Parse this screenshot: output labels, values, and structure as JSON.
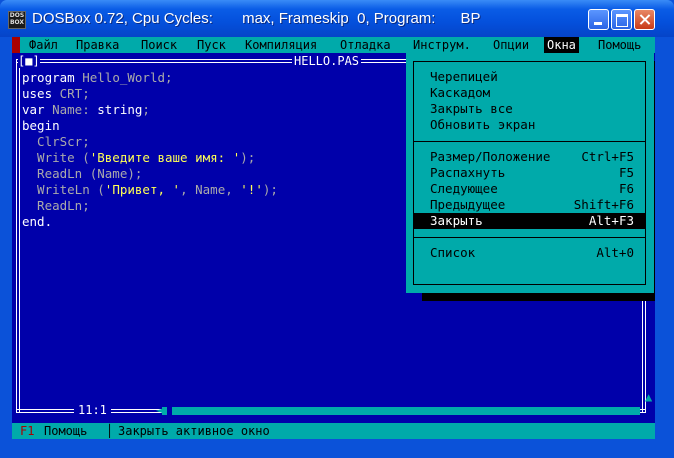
{
  "window": {
    "title": "DOSBox 0.72, Cpu Cycles:       max, Frameskip  0, Program:      BP",
    "icon_text": "DOS BOX"
  },
  "menubar": {
    "items": [
      "Файл",
      "Правка",
      "Поиск",
      "Пуск",
      "Компиляция",
      "Отладка",
      "Инструм.",
      "Опции",
      "Окна",
      "Помощь"
    ],
    "active": "Окна"
  },
  "editor": {
    "close_box": "[■]",
    "file_name": "HELLO.PAS",
    "cursor_position": "11:1",
    "code": [
      "program Hello_World;",
      "uses CRT;",
      "var Name: string;",
      "begin",
      "  ClrScr;",
      "  Write ('Введите ваше имя: ');",
      "  ReadLn (Name);",
      "  WriteLn ('Привет, ', Name, '!');",
      "  ReadLn;",
      "end."
    ]
  },
  "windows_menu": {
    "group1": [
      {
        "label": "Черепицей",
        "shortcut": ""
      },
      {
        "label": "Каскадом",
        "shortcut": ""
      },
      {
        "label": "Закрыть все",
        "shortcut": ""
      },
      {
        "label": "Обновить экран",
        "shortcut": ""
      }
    ],
    "group2": [
      {
        "label": "Размер/Положение",
        "shortcut": "Ctrl+F5"
      },
      {
        "label": "Распахнуть",
        "shortcut": "F5"
      },
      {
        "label": "Следующее",
        "shortcut": "F6"
      },
      {
        "label": "Предыдущее",
        "shortcut": "Shift+F6"
      },
      {
        "label": "Закрыть",
        "shortcut": "Alt+F3"
      }
    ],
    "group3": [
      {
        "label": "Список",
        "shortcut": "Alt+0"
      }
    ],
    "selected": "Закрыть"
  },
  "statusbar": {
    "key": "F1",
    "help": "Помощь",
    "separator": "│",
    "message": "Закрыть активное окно"
  },
  "colors": {
    "dos_blue": "#0000aa",
    "dos_cyan": "#00aaaa",
    "xp_blue": "#0a5ce6"
  }
}
